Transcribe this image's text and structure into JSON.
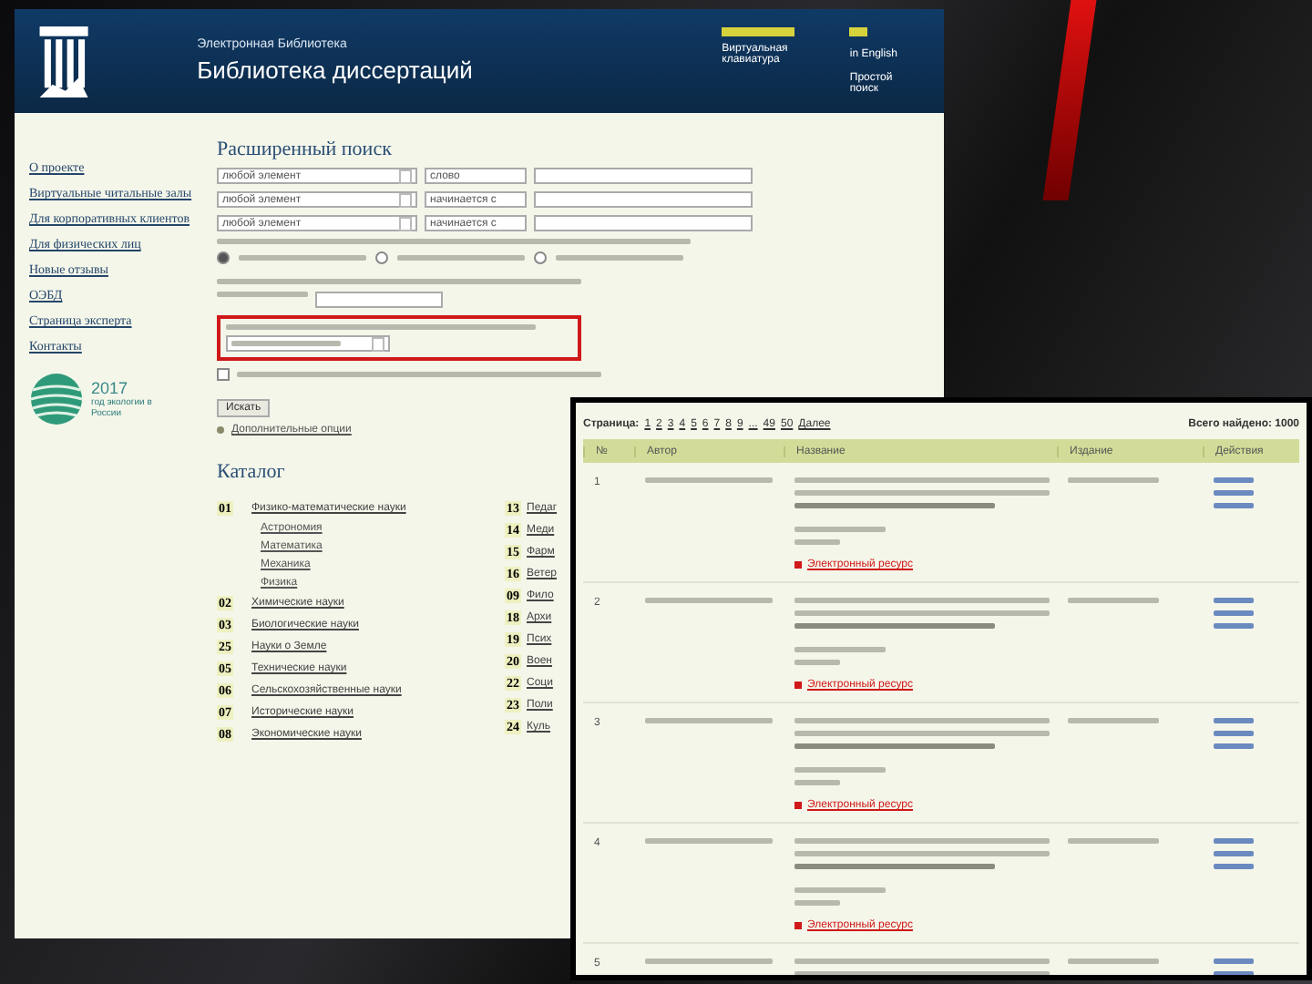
{
  "header": {
    "subtitle": "Электронная Библиотека",
    "title": "Библиотека диссертаций",
    "links": [
      "Виртуальная клавиатура",
      "in English",
      "Простой поиск"
    ]
  },
  "sidebar": {
    "items": [
      "О проекте",
      "Виртуальные читальные залы",
      "Для корпоративных клиентов",
      "Для физических лиц",
      "Новые отзывы",
      "ОЭБД",
      "Страница эксперта",
      "Контакты"
    ],
    "logo": {
      "year": "2017",
      "caption": "год экологии в России"
    }
  },
  "search": {
    "title": "Расширенный поиск",
    "rows": [
      {
        "field": "любой элемент",
        "condition": "слово"
      },
      {
        "field": "любой элемент",
        "condition": "начинается с"
      },
      {
        "field": "любой элемент",
        "condition": "начинается с"
      }
    ],
    "radios": [
      {
        "selected": true
      },
      {
        "selected": false
      },
      {
        "selected": false
      }
    ],
    "only_oebd": {
      "checked": false
    },
    "button": "Искать",
    "extra": "Дополнительные опции"
  },
  "catalog": {
    "title": "Каталог",
    "left": [
      {
        "code": "01",
        "label": "Физико-математические науки",
        "children": [
          "Астрономия",
          "Математика",
          "Механика",
          "Физика"
        ]
      },
      {
        "code": "02",
        "label": "Химические науки"
      },
      {
        "code": "03",
        "label": "Биологические науки"
      },
      {
        "code": "25",
        "label": "Науки о Земле"
      },
      {
        "code": "05",
        "label": "Технические науки"
      },
      {
        "code": "06",
        "label": "Сельскохозяйственные науки"
      },
      {
        "code": "07",
        "label": "Исторические науки"
      },
      {
        "code": "08",
        "label": "Экономические науки"
      }
    ],
    "right": [
      {
        "code": "13",
        "label": "Педаг"
      },
      {
        "code": "14",
        "label": "Меди"
      },
      {
        "code": "15",
        "label": "Фарм"
      },
      {
        "code": "16",
        "label": "Ветер"
      },
      {
        "code": "09",
        "label": "Фило"
      },
      {
        "code": "18",
        "label": "Архи"
      },
      {
        "code": "19",
        "label": "Псих"
      },
      {
        "code": "20",
        "label": "Воен"
      },
      {
        "code": "22",
        "label": "Соци"
      },
      {
        "code": "23",
        "label": "Поли"
      },
      {
        "code": "24",
        "label": "Куль"
      }
    ]
  },
  "results": {
    "pager_label": "Страница:",
    "pages": [
      "1",
      "2",
      "3",
      "4",
      "5",
      "6",
      "7",
      "8",
      "9",
      "...",
      "49",
      "50"
    ],
    "next": "Далее",
    "total": "Всего найдено: 1000",
    "columns": [
      "№",
      "Автор",
      "Название",
      "Издание",
      "Действия"
    ],
    "rows": [
      {
        "number": "1",
        "link": "Электронный ресурс"
      },
      {
        "number": "2",
        "link": "Электронный ресурс"
      },
      {
        "number": "3",
        "link": "Электронный ресурс"
      },
      {
        "number": "4",
        "link": "Электронный ресурс"
      },
      {
        "number": "5"
      }
    ]
  }
}
